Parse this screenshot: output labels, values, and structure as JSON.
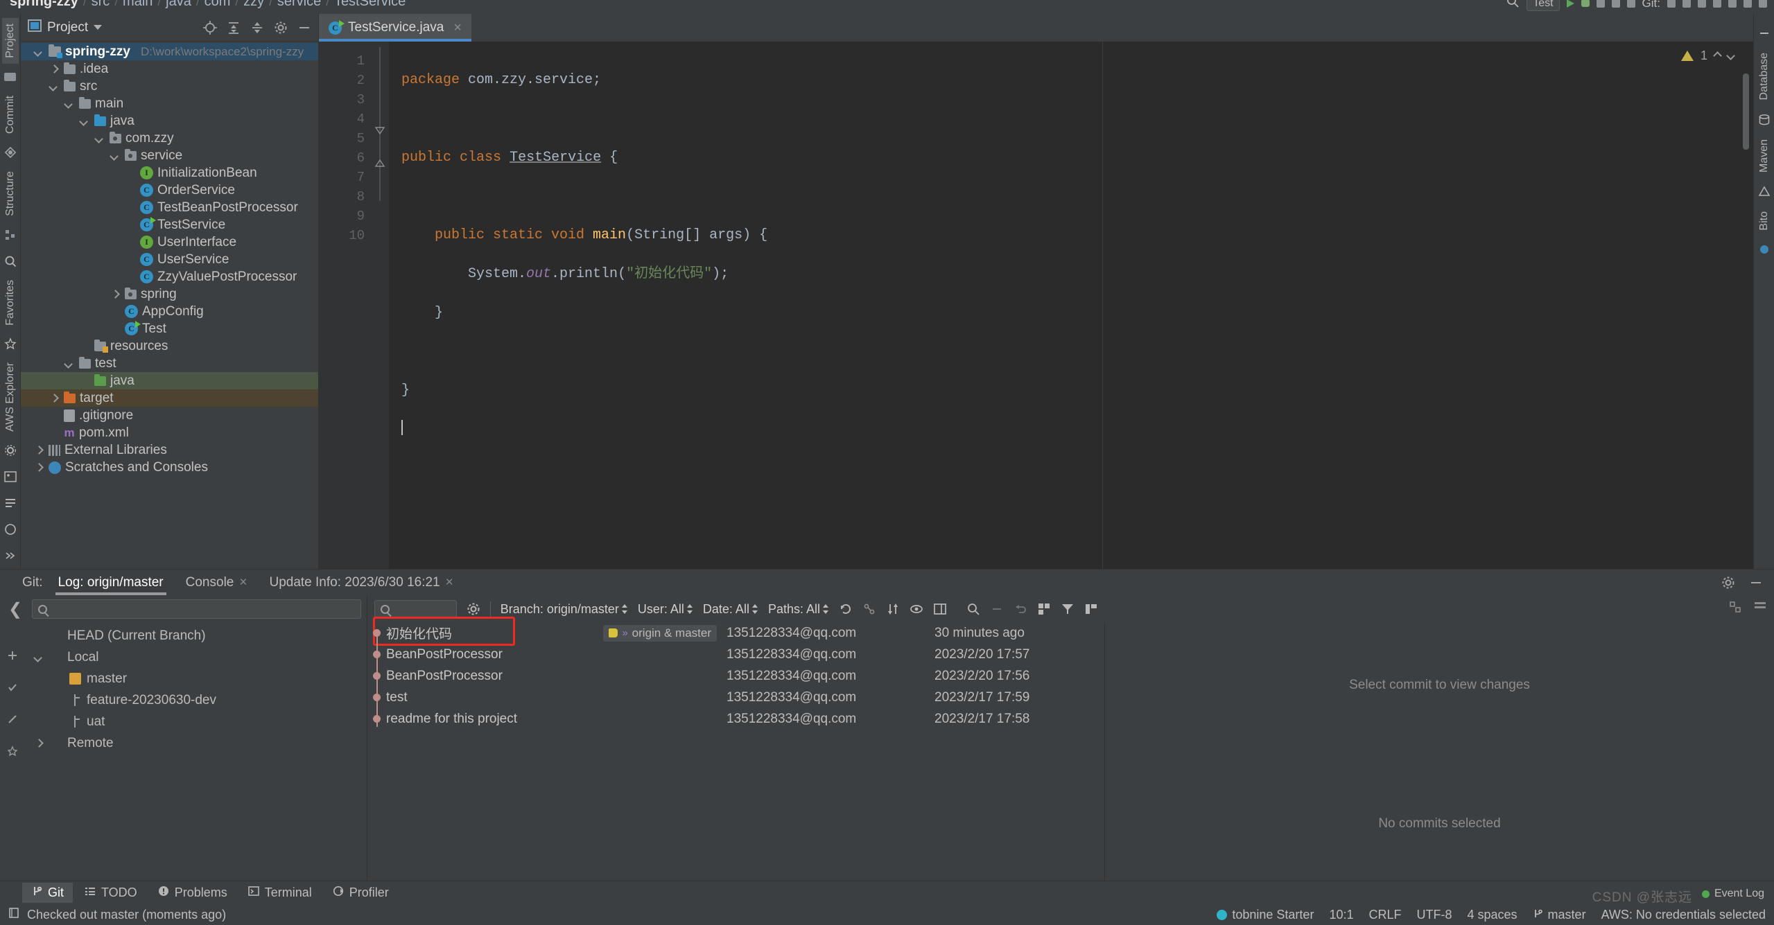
{
  "breadcrumb": {
    "items": [
      "spring-zzy",
      "src",
      "main",
      "java",
      "com",
      "zzy",
      "service",
      "TestService"
    ],
    "separator": "/"
  },
  "topright": {
    "run_config": "Test",
    "more": "⋮"
  },
  "project_panel": {
    "title": "Project",
    "vertical_tabs": [
      "Project",
      "Commit"
    ],
    "tree": [
      {
        "depth": 0,
        "arrow": "down",
        "icon": "project-module-icon",
        "label": "spring-zzy",
        "sub": "D:\\work\\workspace2\\spring-zzy",
        "selected": true
      },
      {
        "depth": 1,
        "arrow": "right",
        "icon": "folder-icon",
        "label": ".idea",
        "sub": ""
      },
      {
        "depth": 1,
        "arrow": "down",
        "icon": "folder-icon",
        "label": "src",
        "sub": ""
      },
      {
        "depth": 2,
        "arrow": "down",
        "icon": "folder-icon",
        "label": "main",
        "sub": ""
      },
      {
        "depth": 3,
        "arrow": "down",
        "icon": "folder-source-icon",
        "label": "java",
        "sub": ""
      },
      {
        "depth": 4,
        "arrow": "down",
        "icon": "package-icon",
        "label": "com.zzy",
        "sub": ""
      },
      {
        "depth": 5,
        "arrow": "down",
        "icon": "package-icon",
        "label": "service",
        "sub": ""
      },
      {
        "depth": 6,
        "arrow": "none",
        "icon": "interface-icon",
        "label": "InitializationBean",
        "sub": ""
      },
      {
        "depth": 6,
        "arrow": "none",
        "icon": "class-icon",
        "label": "OrderService",
        "sub": ""
      },
      {
        "depth": 6,
        "arrow": "none",
        "icon": "class-icon",
        "label": "TestBeanPostProcessor",
        "sub": ""
      },
      {
        "depth": 6,
        "arrow": "none",
        "icon": "class-runnable-icon",
        "label": "TestService",
        "sub": ""
      },
      {
        "depth": 6,
        "arrow": "none",
        "icon": "interface-icon",
        "label": "UserInterface",
        "sub": ""
      },
      {
        "depth": 6,
        "arrow": "none",
        "icon": "class-icon",
        "label": "UserService",
        "sub": ""
      },
      {
        "depth": 6,
        "arrow": "none",
        "icon": "class-icon",
        "label": "ZzyValuePostProcessor",
        "sub": ""
      },
      {
        "depth": 5,
        "arrow": "right",
        "icon": "package-icon",
        "label": "spring",
        "sub": ""
      },
      {
        "depth": 5,
        "arrow": "none",
        "icon": "class-icon",
        "label": "AppConfig",
        "sub": ""
      },
      {
        "depth": 5,
        "arrow": "none",
        "icon": "class-runnable-icon",
        "label": "Test",
        "sub": ""
      },
      {
        "depth": 3,
        "arrow": "none",
        "icon": "folder-resources-icon",
        "label": "resources",
        "sub": ""
      },
      {
        "depth": 2,
        "arrow": "down",
        "icon": "folder-icon",
        "label": "test",
        "sub": ""
      },
      {
        "depth": 3,
        "arrow": "none",
        "icon": "folder-test-source-icon",
        "label": "java",
        "sub": "",
        "row": "green"
      },
      {
        "depth": 1,
        "arrow": "right",
        "icon": "folder-excluded-icon",
        "label": "target",
        "sub": "",
        "row": "orange"
      },
      {
        "depth": 1,
        "arrow": "none",
        "icon": "gitignore-file-icon",
        "label": ".gitignore",
        "sub": ""
      },
      {
        "depth": 1,
        "arrow": "none",
        "icon": "maven-xml-icon",
        "label": "pom.xml",
        "sub": ""
      },
      {
        "depth": 0,
        "arrow": "right",
        "icon": "library-icon",
        "label": "External Libraries",
        "sub": ""
      },
      {
        "depth": 0,
        "arrow": "right",
        "icon": "scratches-icon",
        "label": "Scratches and Consoles",
        "sub": ""
      }
    ]
  },
  "editor": {
    "tab_label": "TestService.java",
    "tab_close": "×",
    "warning_count": "1",
    "lines": [
      {
        "n": "1",
        "gutter_run": false
      },
      {
        "n": "2",
        "gutter_run": false
      },
      {
        "n": "3",
        "gutter_run": true
      },
      {
        "n": "4",
        "gutter_run": false
      },
      {
        "n": "5",
        "gutter_run": true
      },
      {
        "n": "6",
        "gutter_run": false
      },
      {
        "n": "7",
        "gutter_run": false
      },
      {
        "n": "8",
        "gutter_run": false
      },
      {
        "n": "9",
        "gutter_run": false
      },
      {
        "n": "10",
        "gutter_run": false
      }
    ],
    "code": {
      "l1_kw": "package",
      "l1_rest": " com.zzy.service;",
      "l3_kw1": "public",
      "l3_kw2": "class",
      "l3_name": "TestService",
      "l3_brace": " {",
      "l5_kw": "    public static void ",
      "l5_mth": "main",
      "l5_args": "(String[] args) {",
      "l6_a": "        System.",
      "l6_fld": "out",
      "l6_b": ".println(",
      "l6_str": "\"初始化代码\"",
      "l6_c": ");",
      "l7": "    }",
      "l9": "}"
    }
  },
  "right_strip": {
    "items": [
      "Database",
      "Maven",
      "Bito"
    ]
  },
  "git_panel": {
    "label": "Git:",
    "tabs": [
      {
        "label": "Log: origin/master",
        "active": true,
        "closable": false
      },
      {
        "label": "Console",
        "active": false,
        "closable": true
      },
      {
        "label": "Update Info: 2023/6/30 16:21",
        "active": false,
        "closable": true
      }
    ],
    "branch_search_placeholder": "",
    "branches": [
      {
        "level": 0,
        "icon": "head-icon",
        "label": "HEAD (Current Branch)",
        "arrow": "none"
      },
      {
        "level": 0,
        "icon": "none",
        "label": "Local",
        "arrow": "down"
      },
      {
        "level": 1,
        "icon": "tag-icon",
        "label": "master",
        "arrow": "none"
      },
      {
        "level": 1,
        "icon": "branch-icon",
        "label": "feature-20230630-dev",
        "arrow": "none"
      },
      {
        "level": 1,
        "icon": "branch-icon",
        "label": "uat",
        "arrow": "none"
      },
      {
        "level": 0,
        "icon": "none",
        "label": "Remote",
        "arrow": "right"
      }
    ],
    "commit_search_placeholder": "",
    "filters": [
      {
        "label": "Branch: origin/master"
      },
      {
        "label": "User: All"
      },
      {
        "label": "Date: All"
      },
      {
        "label": "Paths: All"
      }
    ],
    "columns": [
      "",
      "",
      ""
    ],
    "commits": [
      {
        "message": "初始化代码",
        "tag": "origin & master",
        "author": "1351228334@qq.com",
        "date": "30 minutes ago",
        "highlight": true
      },
      {
        "message": "BeanPostProcessor",
        "tag": "",
        "author": "1351228334@qq.com",
        "date": "2023/2/20 17:57",
        "highlight": false
      },
      {
        "message": "BeanPostProcessor",
        "tag": "",
        "author": "1351228334@qq.com",
        "date": "2023/2/20 17:56",
        "highlight": false
      },
      {
        "message": "test",
        "tag": "",
        "author": "1351228334@qq.com",
        "date": "2023/2/17 17:59",
        "highlight": false
      },
      {
        "message": "readme for this project",
        "tag": "",
        "author": "1351228334@qq.com",
        "date": "2023/2/17 17:58",
        "highlight": false
      }
    ],
    "detail_placeholder_top": "Select commit to view changes",
    "detail_placeholder_bottom": "No commits selected"
  },
  "bottom_tools": [
    {
      "label": "Git",
      "icon": "git-branch-icon",
      "active": true
    },
    {
      "label": "TODO",
      "icon": "todo-list-icon",
      "active": false
    },
    {
      "label": "Problems",
      "icon": "problems-icon",
      "active": false
    },
    {
      "label": "Terminal",
      "icon": "terminal-icon",
      "active": false
    },
    {
      "label": "Profiler",
      "icon": "profiler-icon",
      "active": false
    }
  ],
  "status_bar": {
    "message": "Checked out master (moments ago)",
    "tabnine": "tobnine Starter",
    "caret": "10:1",
    "line_sep": "CRLF",
    "encoding": "UTF-8",
    "indent": "4 spaces",
    "branch": "master",
    "aws": "AWS: No credentials selected",
    "event_log": "Event Log"
  },
  "watermark": "CSDN @张志远"
}
